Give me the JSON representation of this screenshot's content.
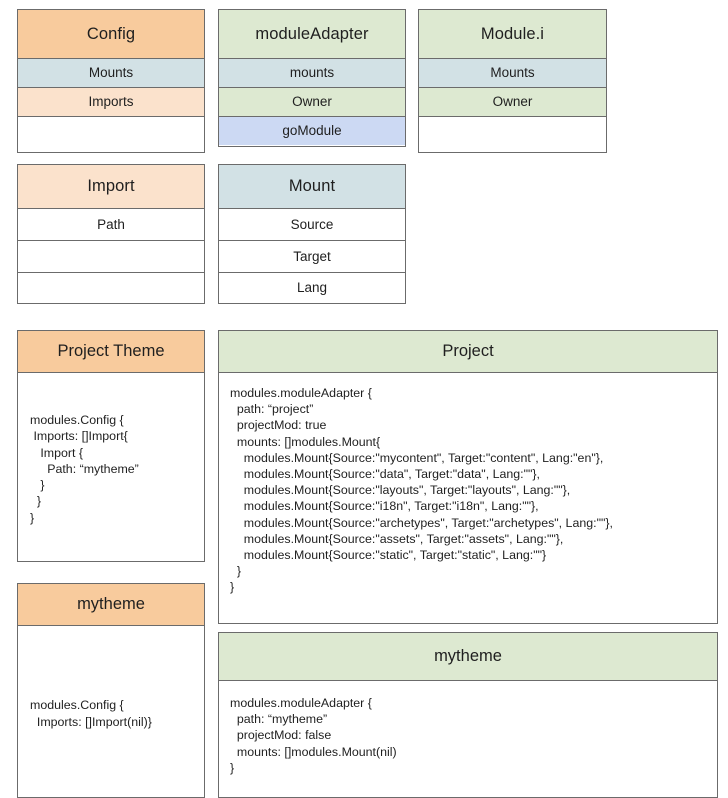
{
  "diagram": {
    "title": "Hugo Modules configuration structures",
    "colors": {
      "orange_header": "#f8cb9d",
      "orange_soft": "#fbe2cc",
      "blue_row": "#d2e1e5",
      "green_header": "#dde9d1",
      "periwinkle_row": "#ccd9f3",
      "white": "#ffffff",
      "border": "#6b6b6b"
    }
  },
  "classes": [
    {
      "id": "config",
      "name": "Config",
      "rows": [
        {
          "label": "Config",
          "fill": "orange",
          "kind": "header"
        },
        {
          "label": "Mounts",
          "fill": "blue",
          "kind": "attribute"
        },
        {
          "label": "Imports",
          "fill": "orange-soft",
          "kind": "attribute"
        },
        {
          "label": "",
          "fill": "white",
          "kind": "empty"
        }
      ]
    },
    {
      "id": "moduleAdapter",
      "name": "moduleAdapter",
      "rows": [
        {
          "label": "moduleAdapter",
          "fill": "green",
          "kind": "header"
        },
        {
          "label": "mounts",
          "fill": "blue",
          "kind": "attribute"
        },
        {
          "label": "Owner",
          "fill": "green",
          "kind": "attribute"
        },
        {
          "label": "goModule",
          "fill": "periwinkle",
          "kind": "attribute"
        }
      ]
    },
    {
      "id": "modulei",
      "name": "Module.i",
      "rows": [
        {
          "label": "Module.i",
          "fill": "green",
          "kind": "header"
        },
        {
          "label": "Mounts",
          "fill": "blue",
          "kind": "attribute"
        },
        {
          "label": "Owner",
          "fill": "green",
          "kind": "attribute"
        },
        {
          "label": "",
          "fill": "white",
          "kind": "empty"
        }
      ]
    },
    {
      "id": "import",
      "name": "Import",
      "rows": [
        {
          "label": "Import",
          "fill": "orange-soft",
          "kind": "header"
        },
        {
          "label": "Path",
          "fill": "white",
          "kind": "attribute"
        },
        {
          "label": "",
          "fill": "white",
          "kind": "empty"
        },
        {
          "label": "",
          "fill": "white",
          "kind": "empty"
        }
      ]
    },
    {
      "id": "mount",
      "name": "Mount",
      "rows": [
        {
          "label": "Mount",
          "fill": "blue",
          "kind": "header"
        },
        {
          "label": "Source",
          "fill": "white",
          "kind": "attribute"
        },
        {
          "label": "Target",
          "fill": "white",
          "kind": "attribute"
        },
        {
          "label": "Lang",
          "fill": "white",
          "kind": "attribute"
        }
      ]
    }
  ],
  "notes": [
    {
      "id": "project-theme-note",
      "title": "Project Theme",
      "title_fill": "orange",
      "code": "modules.Config {\n Imports: []Import{\n   Import {\n     Path: “mytheme”\n   }\n  }\n}"
    },
    {
      "id": "project-note",
      "title": "Project",
      "title_fill": "green",
      "code": "modules.moduleAdapter {\n  path: “project”\n  projectMod: true\n  mounts: []modules.Mount{\n    modules.Mount{Source:\"mycontent\", Target:\"content\", Lang:\"en\"},\n    modules.Mount{Source:\"data\", Target:\"data\", Lang:\"\"},\n    modules.Mount{Source:\"layouts\", Target:\"layouts\", Lang:\"\"},\n    modules.Mount{Source:\"i18n\", Target:\"i18n\", Lang:\"\"},\n    modules.Mount{Source:\"archetypes\", Target:\"archetypes\", Lang:\"\"},\n    modules.Mount{Source:\"assets\", Target:\"assets\", Lang:\"\"},\n    modules.Mount{Source:\"static\", Target:\"static\", Lang:\"\"}\n  }\n}"
    },
    {
      "id": "mytheme-config-note",
      "title": "mytheme",
      "title_fill": "orange",
      "code": "modules.Config {\n  Imports: []Import(nil)}"
    },
    {
      "id": "mytheme-adapter-note",
      "title": "mytheme",
      "title_fill": "green",
      "code": "modules.moduleAdapter {\n  path: “mytheme”\n  projectMod: false\n  mounts: []modules.Mount(nil)\n}"
    }
  ],
  "watermark": ""
}
